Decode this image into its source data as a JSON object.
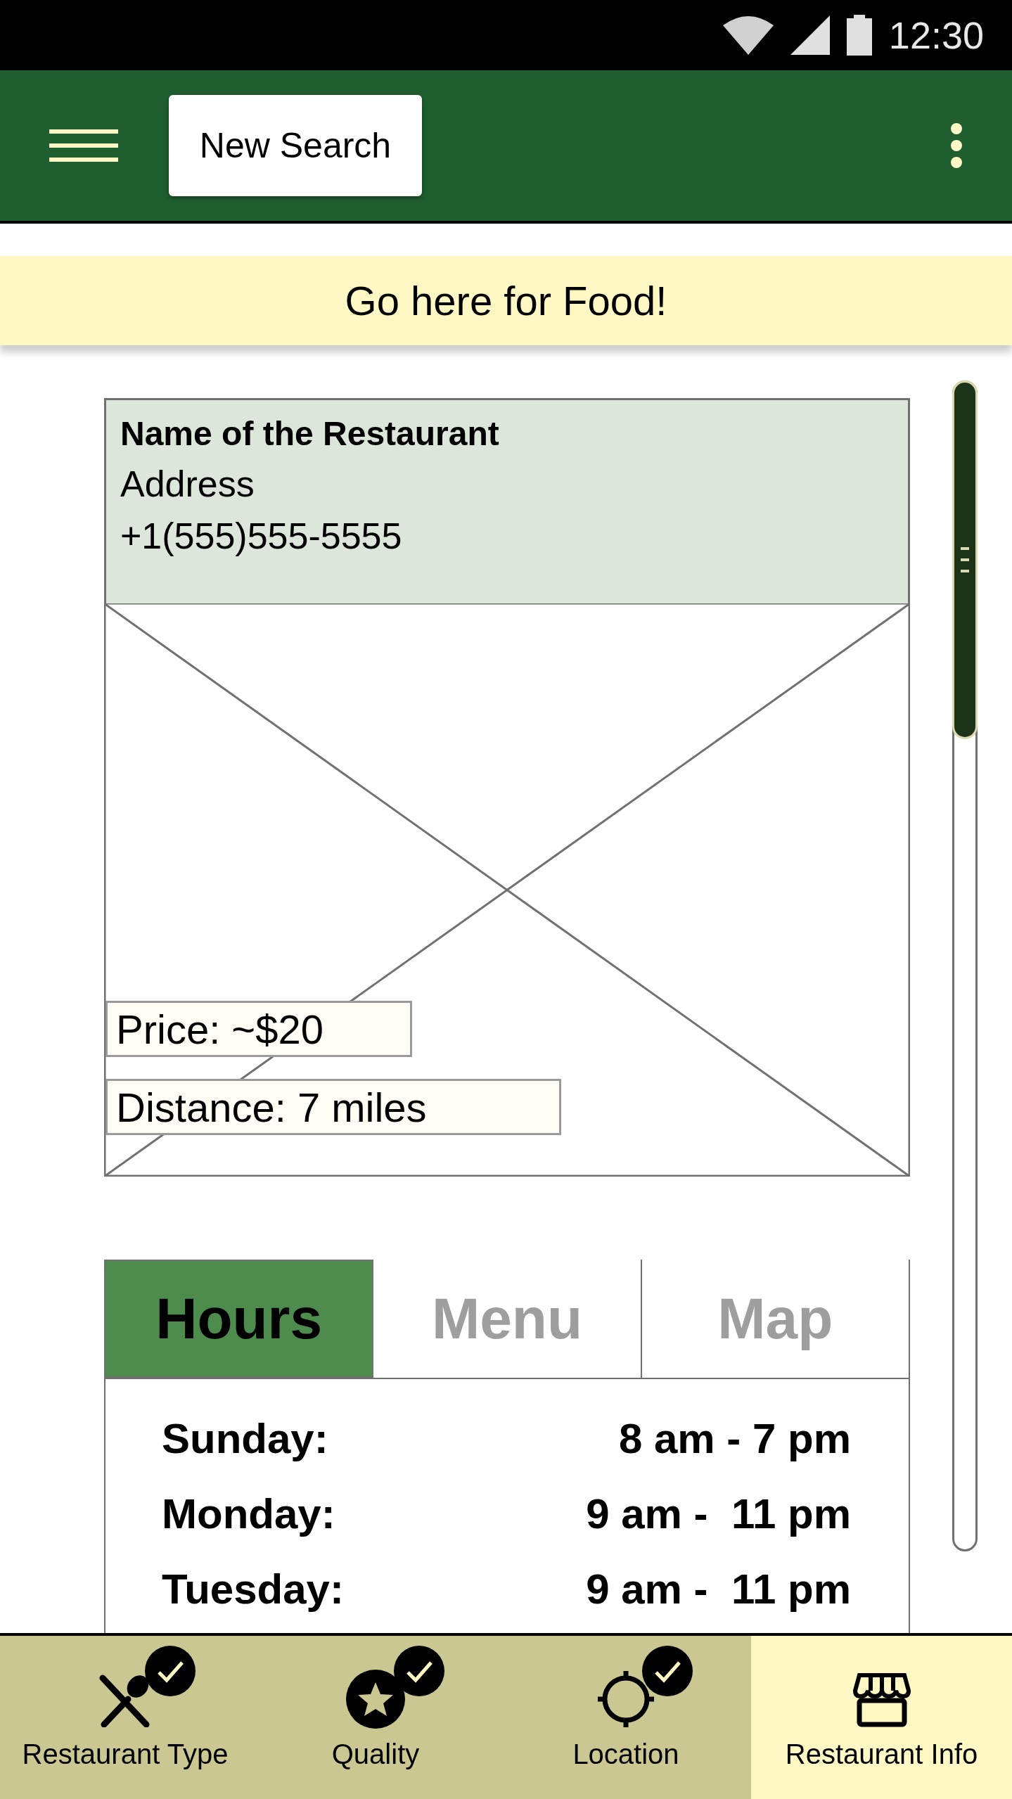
{
  "status_bar": {
    "time": "12:30"
  },
  "app_bar": {
    "button": "New Search"
  },
  "banner": "Go here for Food!",
  "restaurant": {
    "name": "Name of the Restaurant",
    "address": "Address",
    "phone": "+1(555)555-5555",
    "price": "Price: ~$20",
    "distance": "Distance: 7 miles"
  },
  "tabs": [
    {
      "label": "Hours",
      "selected": true
    },
    {
      "label": "Menu",
      "selected": false
    },
    {
      "label": "Map",
      "selected": false
    }
  ],
  "hours": [
    {
      "day": "Sunday:",
      "time": "8 am - 7 pm"
    },
    {
      "day": "Monday:",
      "time": "9 am -  11 pm"
    },
    {
      "day": "Tuesday:",
      "time": "9 am -  11 pm"
    }
  ],
  "bottom_nav": [
    {
      "kind": "utensils",
      "label": "Restaurant Type",
      "checked": true,
      "selected": false
    },
    {
      "kind": "star",
      "label": "Quality",
      "checked": true,
      "selected": false
    },
    {
      "kind": "target",
      "label": "Location",
      "checked": true,
      "selected": false
    },
    {
      "kind": "store",
      "label": "Restaurant Info",
      "checked": false,
      "selected": true
    }
  ]
}
